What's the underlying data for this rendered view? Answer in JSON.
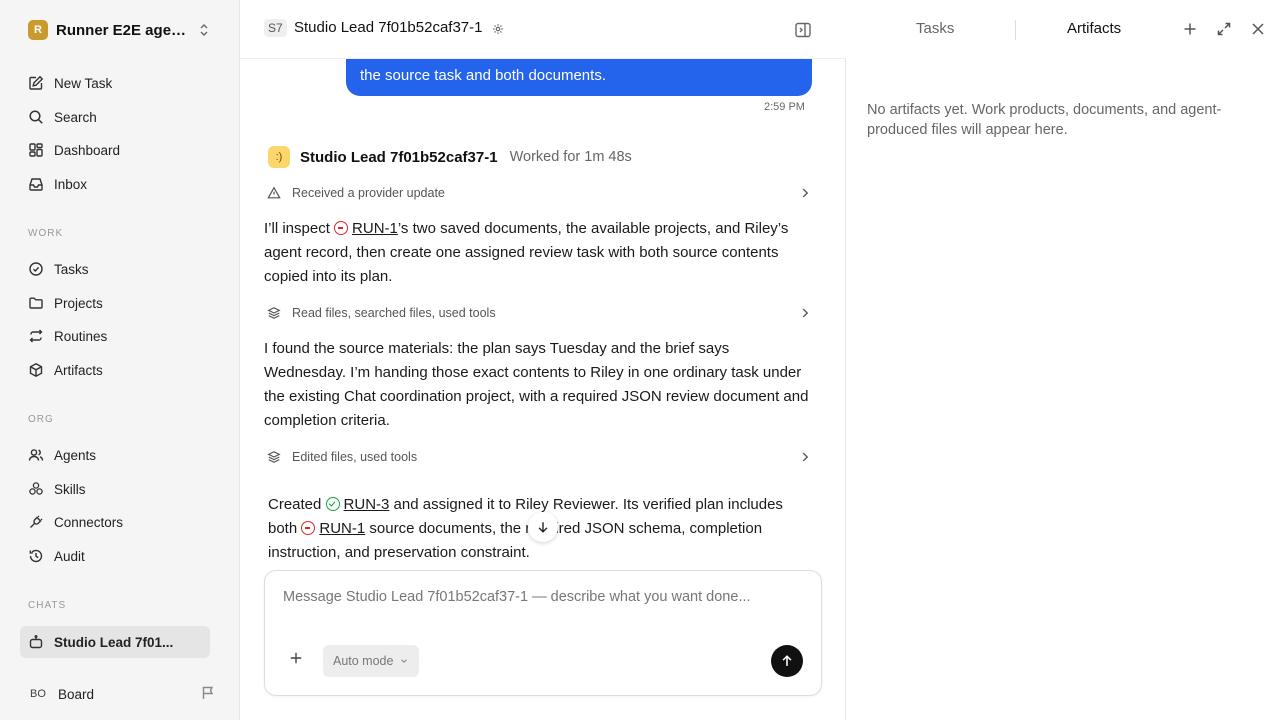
{
  "workspace": {
    "logo_letter": "R",
    "name": "Runner E2E agen..."
  },
  "nav_top": [
    {
      "label": "New Task",
      "icon": "edit-icon"
    },
    {
      "label": "Search",
      "icon": "search-icon"
    },
    {
      "label": "Dashboard",
      "icon": "dashboard-icon"
    },
    {
      "label": "Inbox",
      "icon": "inbox-icon"
    }
  ],
  "sections": {
    "work": "WORK",
    "org": "ORG",
    "chats": "CHATS"
  },
  "nav_work": [
    {
      "label": "Tasks",
      "icon": "check-circle-icon"
    },
    {
      "label": "Projects",
      "icon": "folder-icon"
    },
    {
      "label": "Routines",
      "icon": "repeat-icon"
    },
    {
      "label": "Artifacts",
      "icon": "box-icon"
    }
  ],
  "nav_org": [
    {
      "label": "Agents",
      "icon": "users-icon"
    },
    {
      "label": "Skills",
      "icon": "skills-icon"
    },
    {
      "label": "Connectors",
      "icon": "plug-icon"
    },
    {
      "label": "Audit",
      "icon": "history-icon"
    }
  ],
  "chats": [
    {
      "label": "Studio Lead 7f01..."
    }
  ],
  "user": {
    "initials": "BO",
    "name": "Board"
  },
  "header": {
    "tag": "S7",
    "title": "Studio Lead 7f01b52caf37-1"
  },
  "thread": {
    "user_message": "the source task and both documents.",
    "user_time": "2:59 PM",
    "agent_name": "Studio Lead 7f01b52caf37-1",
    "worked": "Worked for 1m 48s",
    "step1": "Received a provider update",
    "para1_a": "I’ll inspect ",
    "run1": "RUN-1",
    "para1_b": "’s two saved documents, the available projects, and Riley’s agent record, then create one assigned review task with both source contents copied into its plan.",
    "step2": "Read files, searched files, used tools",
    "para2": "I found the source materials: the plan says Tuesday and the brief says Wednesday. I’m handing those exact contents to Riley in one ordinary task under the existing Chat coordination project, with a required JSON review document and completion criteria.",
    "step3": "Edited files, used tools",
    "para3_a": "Created ",
    "run3": "RUN-3",
    "para3_b": " and assigned it to Riley Reviewer. Its verified plan includes both ",
    "para3_c": " source documents, the required JSON schema, completion instruction, and preservation constraint."
  },
  "composer": {
    "placeholder": "Message Studio Lead 7f01b52caf37-1 — describe what you want done...",
    "mode": "Auto mode"
  },
  "right_panel": {
    "tab_tasks": "Tasks",
    "tab_artifacts": "Artifacts",
    "empty": "No artifacts yet. Work products, documents, and agent-produced files will appear here."
  }
}
